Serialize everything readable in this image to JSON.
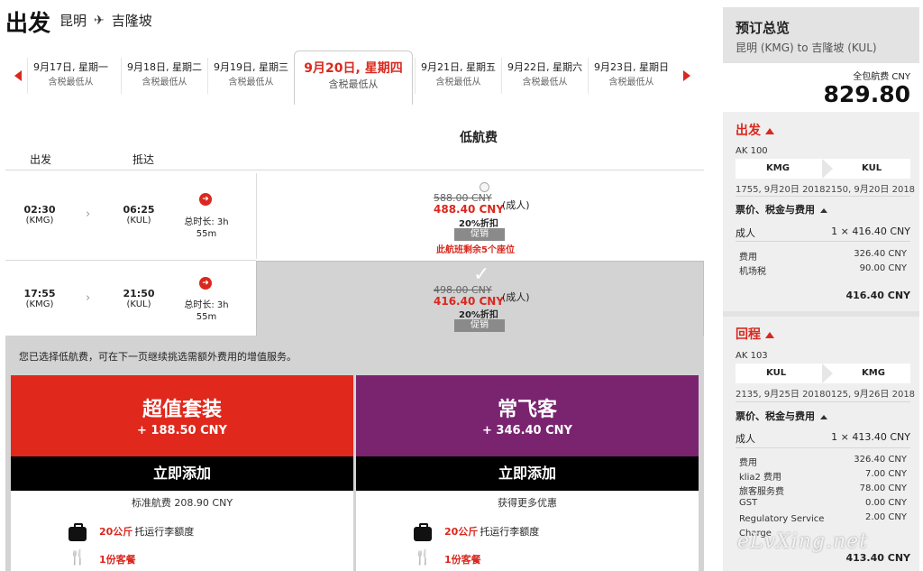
{
  "header": {
    "title": "出发",
    "from": "昆明",
    "to": "吉隆坡",
    "plane_icon": "plane-icon"
  },
  "dates": [
    {
      "date": "9月17日, 星期一",
      "sub": "含税最低从"
    },
    {
      "date": "9月18日, 星期二",
      "sub": "含税最低从"
    },
    {
      "date": "9月19日, 星期三",
      "sub": "含税最低从"
    },
    {
      "date": "9月20日, 星期四",
      "sub": "含税最低从",
      "selected": true
    },
    {
      "date": "9月21日, 星期五",
      "sub": "含税最低从"
    },
    {
      "date": "9月22日, 星期六",
      "sub": "含税最低从"
    },
    {
      "date": "9月23日, 星期日",
      "sub": "含税最低从"
    }
  ],
  "table": {
    "lowfare_header": "低航费",
    "col_depart": "出发",
    "col_arrive": "抵达"
  },
  "flights": [
    {
      "dep_time": "02:30",
      "dep_code": "(KMG)",
      "arr_time": "06:25",
      "arr_code": "(KUL)",
      "duration_a": "总时长: 3h",
      "duration_b": "55m",
      "orig_price": "588.00 CNY",
      "price": "488.40 CNY",
      "pax": "(成人)",
      "discount": "20%折扣",
      "promo": "促销",
      "seats_left": "此航班剩余5个座位",
      "selected": false
    },
    {
      "dep_time": "17:55",
      "dep_code": "(KMG)",
      "arr_time": "21:50",
      "arr_code": "(KUL)",
      "duration_a": "总时长: 3h",
      "duration_b": "55m",
      "orig_price": "498.00 CNY",
      "price": "416.40 CNY",
      "pax": "(成人)",
      "discount": "20%折扣",
      "promo": "促销",
      "seats_left": "",
      "selected": true
    }
  ],
  "selection": {
    "note": "您已选择低航费，可在下一页继续挑选需额外费用的增值服务。",
    "packages": [
      {
        "name": "超值套装",
        "price": "+ 188.50 CNY",
        "button": "立即添加",
        "sub": "标准航费 208.90 CNY",
        "color": "#e0281c",
        "features": [
          {
            "hl": "20公斤",
            "text": "托运行李额度"
          },
          {
            "hl": "1份客餐",
            "text": ""
          }
        ]
      },
      {
        "name": "常飞客",
        "price": "+ 346.40 CNY",
        "button": "立即添加",
        "sub": "获得更多优惠",
        "color": "#7a2470",
        "features": [
          {
            "hl": "20公斤",
            "text": "托运行李额度"
          },
          {
            "hl": "1份客餐",
            "text": ""
          }
        ]
      }
    ]
  },
  "summary": {
    "title": "预订总览",
    "route": "昆明 (KMG) to 吉隆坡 (KUL)",
    "total_label": "全包航费 CNY",
    "total": "829.80",
    "outbound": {
      "label": "出发",
      "flight_no": "AK 100",
      "from": "KMG",
      "to": "KUL",
      "times": "1755, 9月20日 20182150, 9月20日 2018",
      "fees_label": "票价、税金与费用",
      "adult_label": "成人",
      "adult_value": "1 × 416.40 CNY",
      "items": [
        {
          "label": "费用",
          "value": "326.40 CNY"
        },
        {
          "label": "机场税",
          "value": "90.00 CNY"
        }
      ],
      "subtotal": "416.40 CNY"
    },
    "return": {
      "label": "回程",
      "flight_no": "AK 103",
      "from": "KUL",
      "to": "KMG",
      "times": "2135, 9月25日 20180125, 9月26日 2018",
      "fees_label": "票价、税金与费用",
      "adult_label": "成人",
      "adult_value": "1 × 413.40 CNY",
      "items": [
        {
          "label": "费用",
          "value": "326.40 CNY"
        },
        {
          "label": "klia2 费用",
          "value": "7.00 CNY"
        },
        {
          "label": "旅客服务费",
          "value": "78.00 CNY"
        },
        {
          "label": "GST",
          "value": "0.00 CNY"
        },
        {
          "label": "Regulatory Service Charge",
          "value": "2.00 CNY"
        }
      ],
      "subtotal": "413.40 CNY"
    }
  },
  "watermark": "eLvXing.net",
  "colors": {
    "accent": "#d9281e",
    "value_pack": "#e0281c",
    "premium_flex": "#7a2470"
  }
}
